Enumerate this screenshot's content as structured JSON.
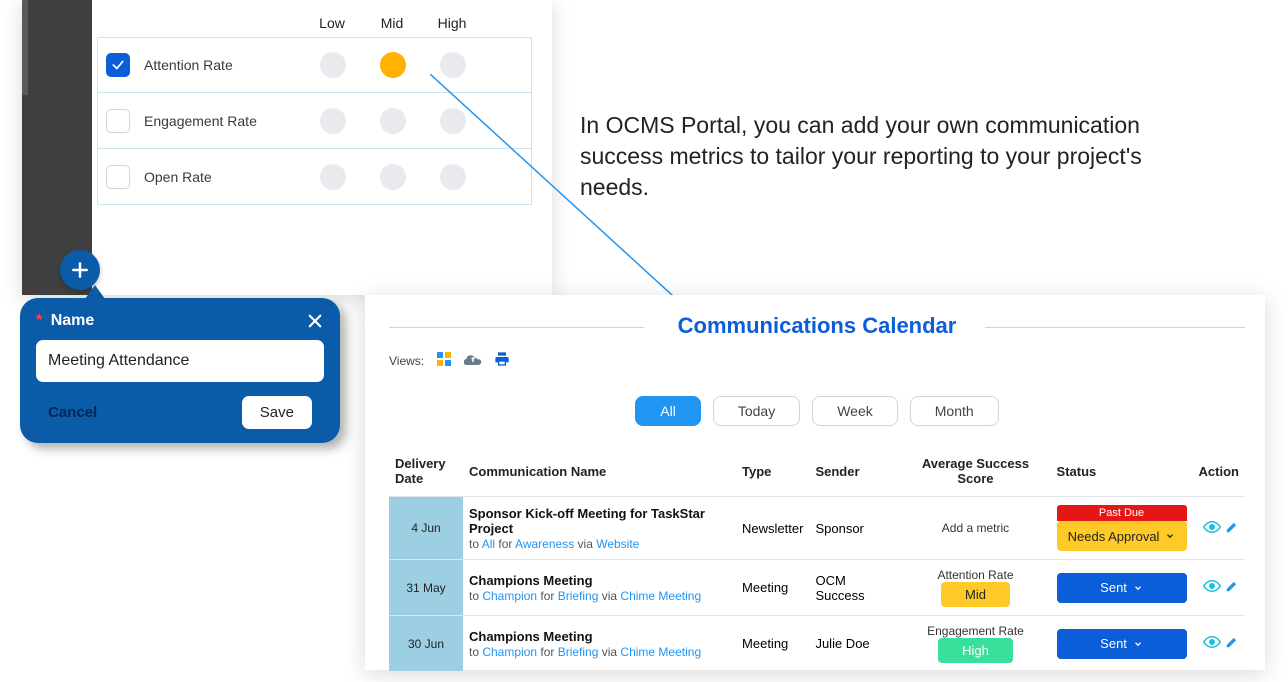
{
  "caption": "In OCMS Portal, you can add your own communication success metrics to tailor your reporting to your project's needs.",
  "metrics": {
    "headers": {
      "low": "Low",
      "mid": "Mid",
      "high": "High"
    },
    "rows": [
      {
        "label": "Attention Rate",
        "checked": true,
        "active": "mid"
      },
      {
        "label": "Engagement Rate",
        "checked": false,
        "active": null
      },
      {
        "label": "Open Rate",
        "checked": false,
        "active": null
      }
    ]
  },
  "popup": {
    "name_label": "Name",
    "value": "Meeting Attendance",
    "cancel": "Cancel",
    "save": "Save"
  },
  "calendar": {
    "title": "Communications Calendar",
    "views_label": "Views:",
    "tabs": {
      "all": "All",
      "today": "Today",
      "week": "Week",
      "month": "Month"
    },
    "columns": {
      "date": "Delivery Date",
      "comm": "Communication Name",
      "type": "Type",
      "sender": "Sender",
      "score": "Average Success Score",
      "status": "Status",
      "action": "Action"
    },
    "rows": [
      {
        "date": "4 Jun",
        "name": "Sponsor Kick-off Meeting for TaskStar Project",
        "to": "All",
        "for": "Awareness",
        "via": "Website",
        "type": "Newsletter",
        "sender": "Sponsor",
        "score_label": "Add a metric",
        "score_value": "",
        "pastdue": "Past Due",
        "status": "Needs Approval",
        "status_class": "approve"
      },
      {
        "date": "31 May",
        "name": "Champions Meeting",
        "to": "Champion",
        "for": "Briefing",
        "via": "Chime Meeting",
        "type": "Meeting",
        "sender": "OCM Success",
        "score_label": "Attention Rate",
        "score_value": "Mid",
        "score_class": "mid",
        "status": "Sent",
        "status_class": "sent"
      },
      {
        "date": "30 Jun",
        "name": "Champions Meeting",
        "to": "Champion",
        "for": "Briefing",
        "via": "Chime Meeting",
        "type": "Meeting",
        "sender": "Julie Doe",
        "score_label": "Engagement Rate",
        "score_value": "High",
        "score_class": "high",
        "status": "Sent",
        "status_class": "sent"
      }
    ],
    "sub_words": {
      "to": "to",
      "for": "for",
      "via": "via"
    }
  }
}
